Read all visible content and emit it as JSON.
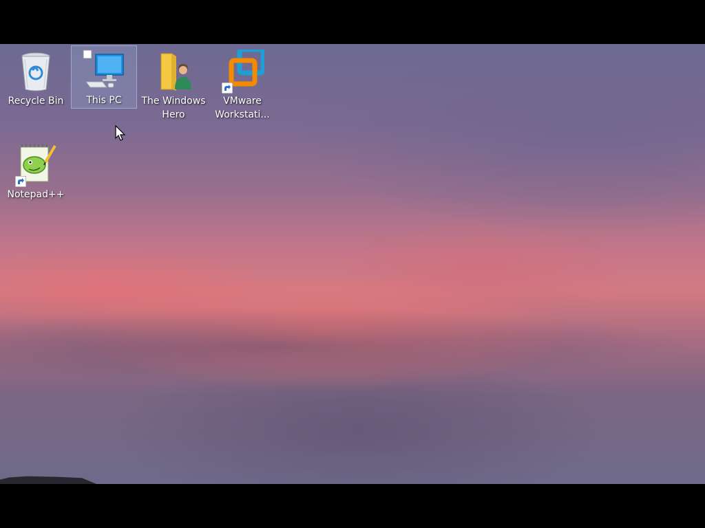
{
  "desktop": {
    "icons": [
      {
        "label": "Recycle Bin",
        "icon": "recycle-bin-icon",
        "selected": false
      },
      {
        "label": "This PC",
        "icon": "computer-icon",
        "selected": true
      },
      {
        "label": "The Windows Hero",
        "icon": "user-folder-icon",
        "selected": false
      },
      {
        "label": "VMware Workstati...",
        "icon": "vmware-icon",
        "selected": false,
        "shortcut": true
      },
      {
        "label": "Notepad++",
        "icon": "notepad-plus-plus-icon",
        "selected": false,
        "shortcut": true
      }
    ]
  },
  "colors": {
    "accent_selection": "#96aad2",
    "vmware_orange": "#f38b00",
    "vmware_blue": "#1d9fd6",
    "folder_yellow": "#f4c842"
  }
}
